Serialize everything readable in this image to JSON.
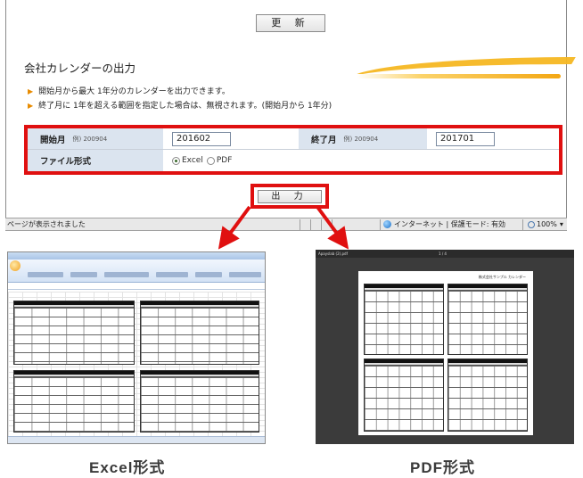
{
  "page": {
    "update_button": "更 新",
    "section_title": "会社カレンダーの出力",
    "notes": [
      "開始月から最大 1年分のカレンダーを出力できます。",
      "終了月に 1年を超える範囲を指定した場合は、無視されます。(開始月から 1年分)"
    ],
    "form": {
      "start_label": "開始月",
      "start_example": "例) 200904",
      "start_value": "201602",
      "end_label": "終了月",
      "end_example": "例) 200904",
      "end_value": "201701",
      "format_label": "ファイル形式",
      "format_options": [
        "Excel",
        "PDF"
      ],
      "format_selected": "Excel"
    },
    "output_button": "出 力"
  },
  "statusbar": {
    "left_text": "ページが表示されました",
    "zone_text": "インターネット | 保護モード: 有効",
    "zoom_text": "100%"
  },
  "excel_screenshot": {},
  "pdf_screenshot": {
    "file_name": "Apayslab (2).pdf",
    "page_indicator": "1 / 4",
    "heading": "株式会社サンプル カレンダー"
  },
  "captions": {
    "excel": "Excel形式",
    "pdf": "PDF形式"
  },
  "colors": {
    "highlight_red": "#e01010",
    "accent_orange": "#f3a713",
    "label_bg": "#dbe4ef"
  }
}
